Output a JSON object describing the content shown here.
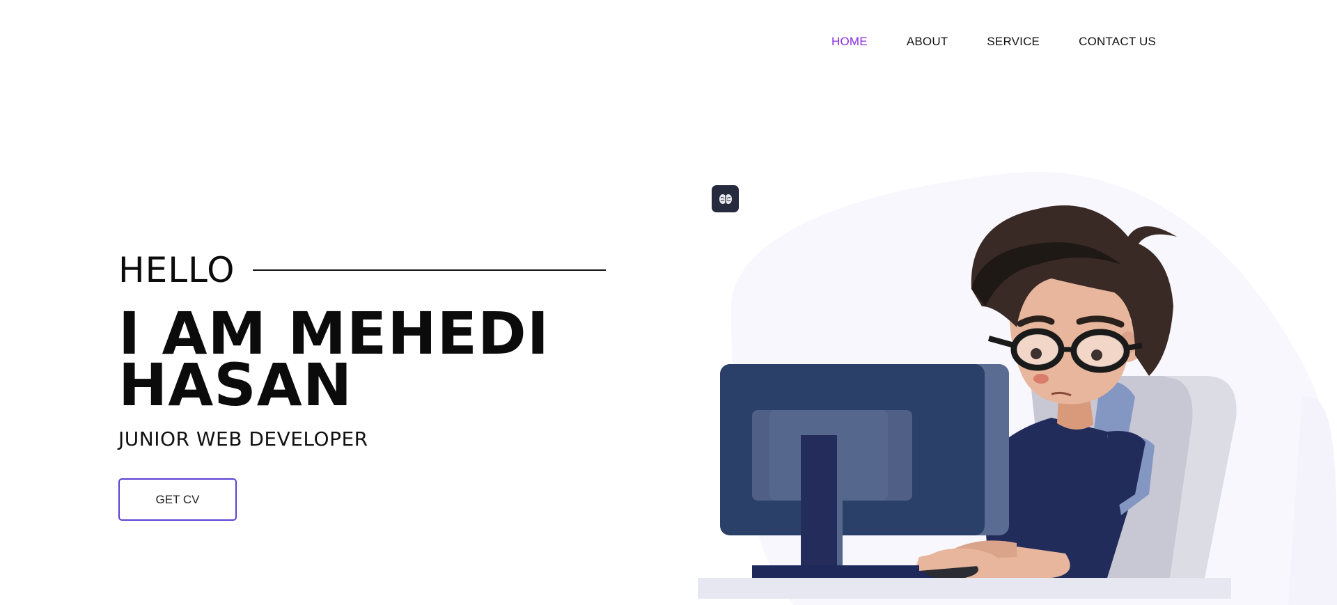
{
  "nav": {
    "items": [
      {
        "label": "HOME",
        "active": true
      },
      {
        "label": "ABOUT",
        "active": false
      },
      {
        "label": "SERVICE",
        "active": false
      },
      {
        "label": "CONTACT US",
        "active": false
      }
    ]
  },
  "hero": {
    "greeting": "HELLO",
    "name_line1": "I AM MEHEDI",
    "name_line2": "HASAN",
    "role": "JUNIOR WEB DEVELOPER",
    "cv_button": "GET CV"
  },
  "colors": {
    "accent": "#8a2be2",
    "button_border": "#5b3fd6",
    "blob": "#f8f7fd",
    "icon_bg": "#262a3d"
  },
  "icons": {
    "brain": "brain-icon"
  }
}
